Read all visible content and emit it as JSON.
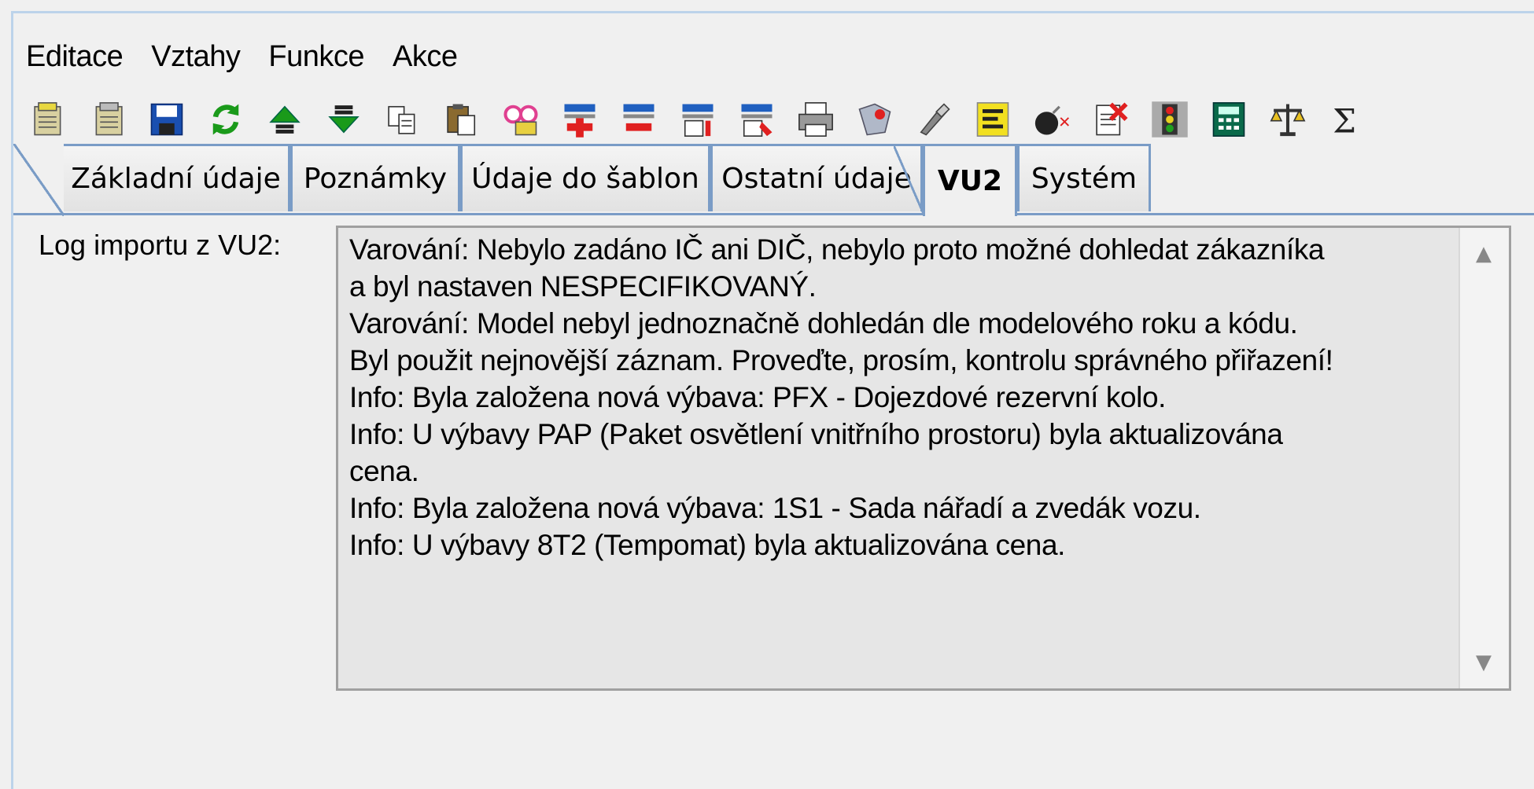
{
  "menu": [
    "Editace",
    "Vztahy",
    "Funkce",
    "Akce"
  ],
  "toolbar": [
    "new-record-icon",
    "copy-record-icon",
    "save-icon",
    "refresh-icon",
    "move-up-icon",
    "move-down-icon",
    "copy-icon",
    "paste-icon",
    "glasses-icon",
    "add-row-icon",
    "remove-row-icon",
    "insert-row-icon",
    "edit-row-icon",
    "print-icon",
    "map-icon",
    "pin-icon",
    "note-icon",
    "bomb-icon",
    "delete-document-icon",
    "traffic-light-icon",
    "calculator-icon",
    "scales-icon",
    "sum-icon"
  ],
  "tabs": [
    {
      "label": "Základní údaje",
      "active": false
    },
    {
      "label": "Poznámky",
      "active": false
    },
    {
      "label": "Údaje do šablon",
      "active": false
    },
    {
      "label": "Ostatní údaje",
      "active": false
    },
    {
      "label": "VU2",
      "active": true
    },
    {
      "label": "Systém",
      "active": false
    }
  ],
  "log": {
    "label": "Log importu z VU2:",
    "lines": [
      "Varování: Nebylo zadáno IČ ani DIČ, nebylo proto možné dohledat zákazníka",
      "a byl nastaven NESPECIFIKOVANÝ.",
      "Varování: Model nebyl jednoznačně dohledán dle modelového roku a kódu.",
      "Byl použit nejnovější záznam. Proveďte, prosím, kontrolu správného přiřazení!",
      "Info: Byla založena nová výbava: PFX - Dojezdové rezervní kolo.",
      "Info: U výbavy PAP (Paket osvětlení vnitřního prostoru) byla aktualizována",
      "cena.",
      "Info: Byla založena nová výbava: 1S1 - Sada nářadí a zvedák vozu.",
      "Info: U výbavy 8T2 (Tempomat) byla aktualizována cena."
    ]
  }
}
